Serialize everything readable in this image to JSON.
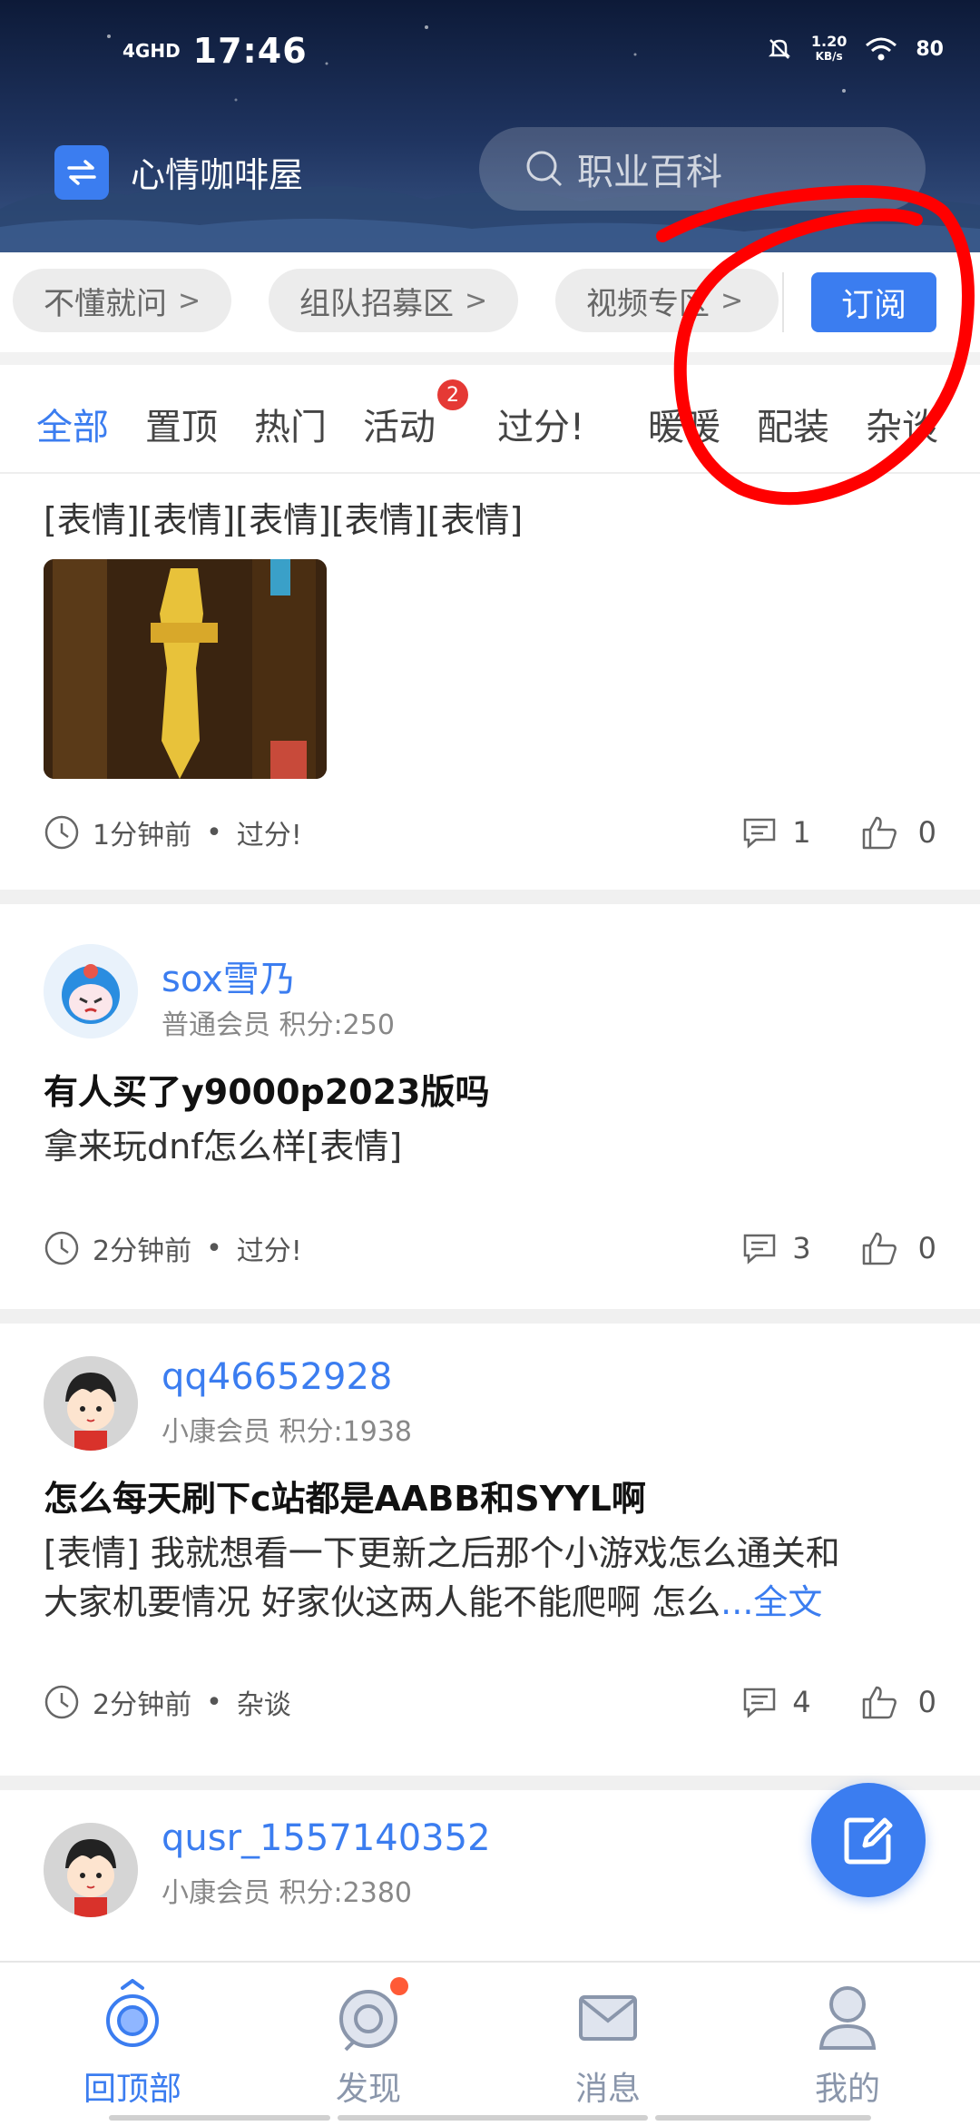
{
  "status_bar": {
    "network": "4GHD",
    "time": "17:46",
    "speed_value": "1.20",
    "speed_unit": "KB/s",
    "battery": "80"
  },
  "app_bar": {
    "title": "心情咖啡屋",
    "search_placeholder": "职业百科"
  },
  "chips": [
    {
      "label": "不懂就问"
    },
    {
      "label": "组队招募区"
    },
    {
      "label": "视频专区"
    }
  ],
  "subscribe_label": "订阅",
  "tabs": [
    {
      "label": "全部"
    },
    {
      "label": "置顶"
    },
    {
      "label": "热门"
    },
    {
      "label": "活动"
    },
    {
      "label": "过分!"
    },
    {
      "label": "暖暖"
    },
    {
      "label": "配装"
    },
    {
      "label": "杂谈"
    }
  ],
  "tab_badge": "2",
  "posts": [
    {
      "body": "[表情][表情][表情][表情][表情]",
      "time": "1分钟前",
      "category": "过分!",
      "comments": "1",
      "likes": "0"
    },
    {
      "username": "sox雪乃",
      "rank": "普通会员",
      "points": "积分:250",
      "title": "有人买了y9000p2023版吗",
      "body": "拿来玩dnf怎么样[表情]",
      "time": "2分钟前",
      "category": "过分!",
      "comments": "3",
      "likes": "0"
    },
    {
      "username": "qq46652928",
      "rank": "小康会员",
      "points": "积分:1938",
      "title": "怎么每天刷下c站都是AABB和SYYL啊",
      "body_line1": "[表情] 我就想看一下更新之后那个小游戏怎么通关和",
      "body_line2": "大家机要情况 好家伙这两人能不能爬啊 怎么",
      "more": "...全文",
      "time": "2分钟前",
      "category": "杂谈",
      "comments": "4",
      "likes": "0"
    },
    {
      "username": "qusr_1557140352",
      "rank": "小康会员",
      "points": "积分:2380"
    }
  ],
  "bottom_nav": [
    {
      "label": "回顶部"
    },
    {
      "label": "发现"
    },
    {
      "label": "消息"
    },
    {
      "label": "我的"
    }
  ],
  "colors": {
    "accent": "#3b7df0",
    "badge": "#e53935",
    "annotation": "#ff0000"
  }
}
